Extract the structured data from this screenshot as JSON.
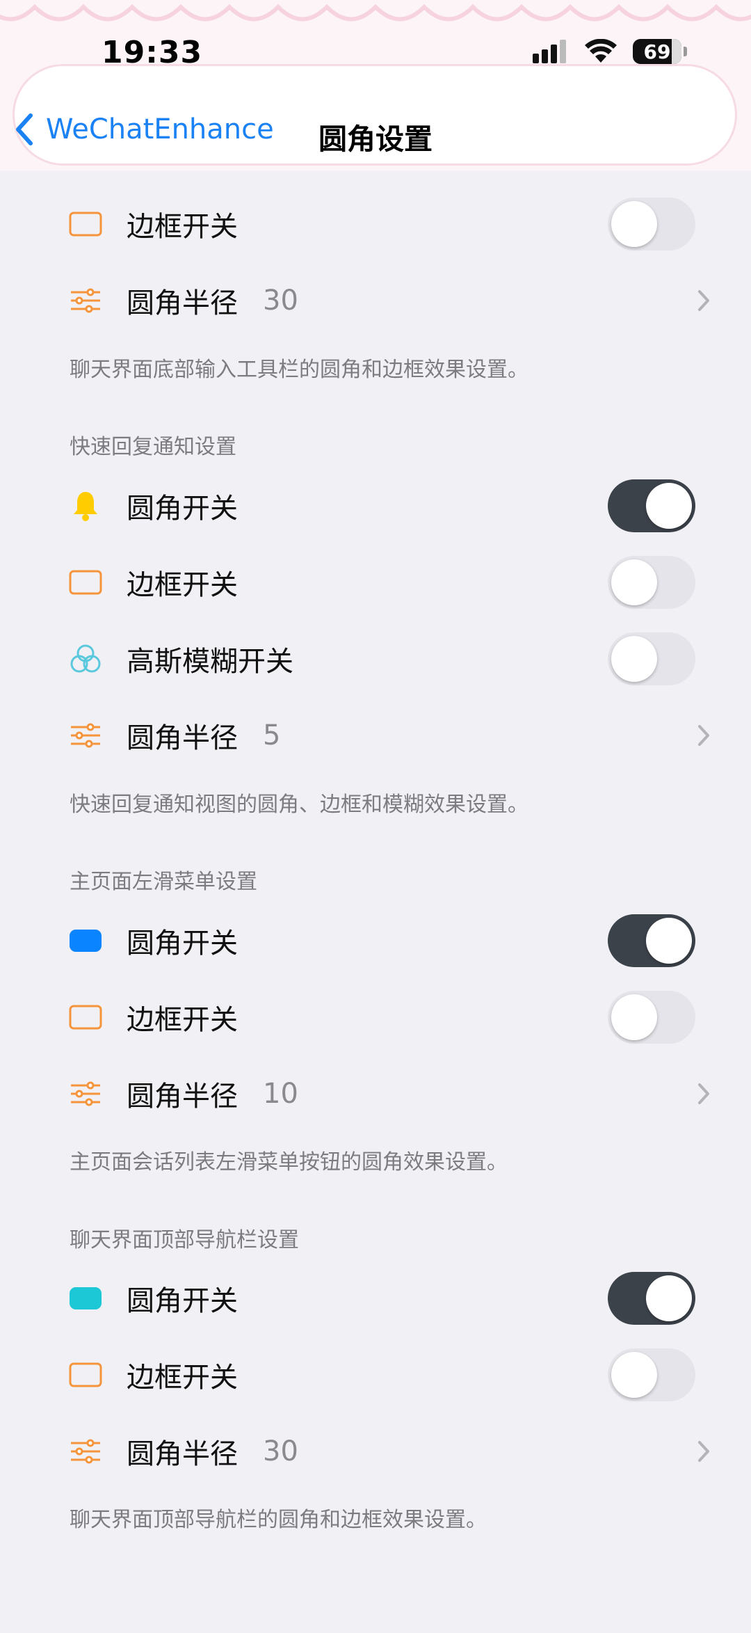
{
  "status_bar": {
    "time": "19:33",
    "battery": "69"
  },
  "nav": {
    "back_label": "WeChatEnhance",
    "title": "圆角设置"
  },
  "sections": [
    {
      "rows": [
        {
          "icon": "border-square-icon",
          "label": "边框开关",
          "type": "toggle",
          "on": false
        },
        {
          "icon": "sliders-icon",
          "label": "圆角半径",
          "type": "value",
          "value": "30"
        }
      ],
      "footer": "聊天界面底部输入工具栏的圆角和边框效果设置。"
    },
    {
      "header": "快速回复通知设置",
      "rows": [
        {
          "icon": "bell-icon",
          "label": "圆角开关",
          "type": "toggle",
          "on": true
        },
        {
          "icon": "border-square-icon",
          "label": "边框开关",
          "type": "toggle",
          "on": false
        },
        {
          "icon": "blur-circles-icon",
          "label": "高斯模糊开关",
          "type": "toggle",
          "on": false
        },
        {
          "icon": "sliders-icon",
          "label": "圆角半径",
          "type": "value",
          "value": "5"
        }
      ],
      "footer": "快速回复通知视图的圆角、边框和模糊效果设置。"
    },
    {
      "header": "主页面左滑菜单设置",
      "rows": [
        {
          "icon": "blue-rounded-rect-icon",
          "label": "圆角开关",
          "type": "toggle",
          "on": true
        },
        {
          "icon": "border-square-icon",
          "label": "边框开关",
          "type": "toggle",
          "on": false
        },
        {
          "icon": "sliders-icon",
          "label": "圆角半径",
          "type": "value",
          "value": "10"
        }
      ],
      "footer": "主页面会话列表左滑菜单按钮的圆角效果设置。"
    },
    {
      "header": "聊天界面顶部导航栏设置",
      "rows": [
        {
          "icon": "teal-rounded-rect-icon",
          "label": "圆角开关",
          "type": "toggle",
          "on": true
        },
        {
          "icon": "border-square-icon",
          "label": "边框开关",
          "type": "toggle",
          "on": false
        },
        {
          "icon": "sliders-icon",
          "label": "圆角半径",
          "type": "value",
          "value": "30"
        }
      ],
      "footer": "聊天界面顶部导航栏的圆角和边框效果设置。"
    }
  ],
  "colors": {
    "accent_blue": "#1a82f5",
    "orange": "#f5943a",
    "toggle_on": "#3c424a",
    "toggle_off": "#e4e4ea"
  }
}
